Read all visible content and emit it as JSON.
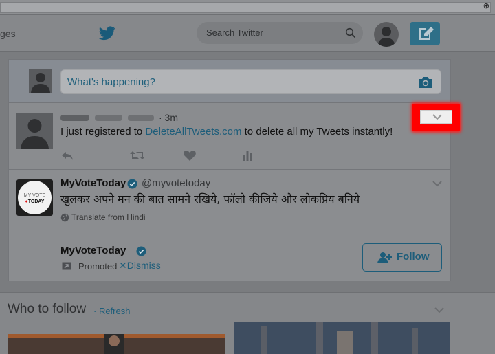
{
  "browser": {
    "zoom_icon": "zoom-icon"
  },
  "nav": {
    "partial_label": "ges",
    "logo_icon": "twitter-bird-icon",
    "search_placeholder": "Search Twitter",
    "compose_icon": "compose-tweet-icon"
  },
  "compose": {
    "placeholder": "What's happening?"
  },
  "tweet": {
    "time": "· 3m",
    "text_before": "I just registered to ",
    "link_text": "DeleteAllTweets.com",
    "text_after": " to delete all my Tweets instantly!",
    "actions": [
      "reply-icon",
      "retweet-icon",
      "like-icon",
      "analytics-icon"
    ]
  },
  "promo": {
    "logo_text_top": "MY VOTE",
    "logo_text_bottom": "TODAY",
    "name": "MyVoteToday",
    "handle": "@myvotetoday",
    "hindi_text": "खुलकर अपने मन की बात सामने रखिये, फॉलो कीजिये और लोकप्रिय बनिये",
    "translate": "Translate from Hindi",
    "name2": "MyVoteToday",
    "promoted": "Promoted",
    "dismiss": "Dismiss",
    "dismiss_x": "✕",
    "follow": "Follow"
  },
  "who_to_follow": {
    "title": "Who to follow",
    "refresh": "· Refresh"
  },
  "colors": {
    "accent": "#1d5d7a",
    "highlight": "#ff0000"
  }
}
